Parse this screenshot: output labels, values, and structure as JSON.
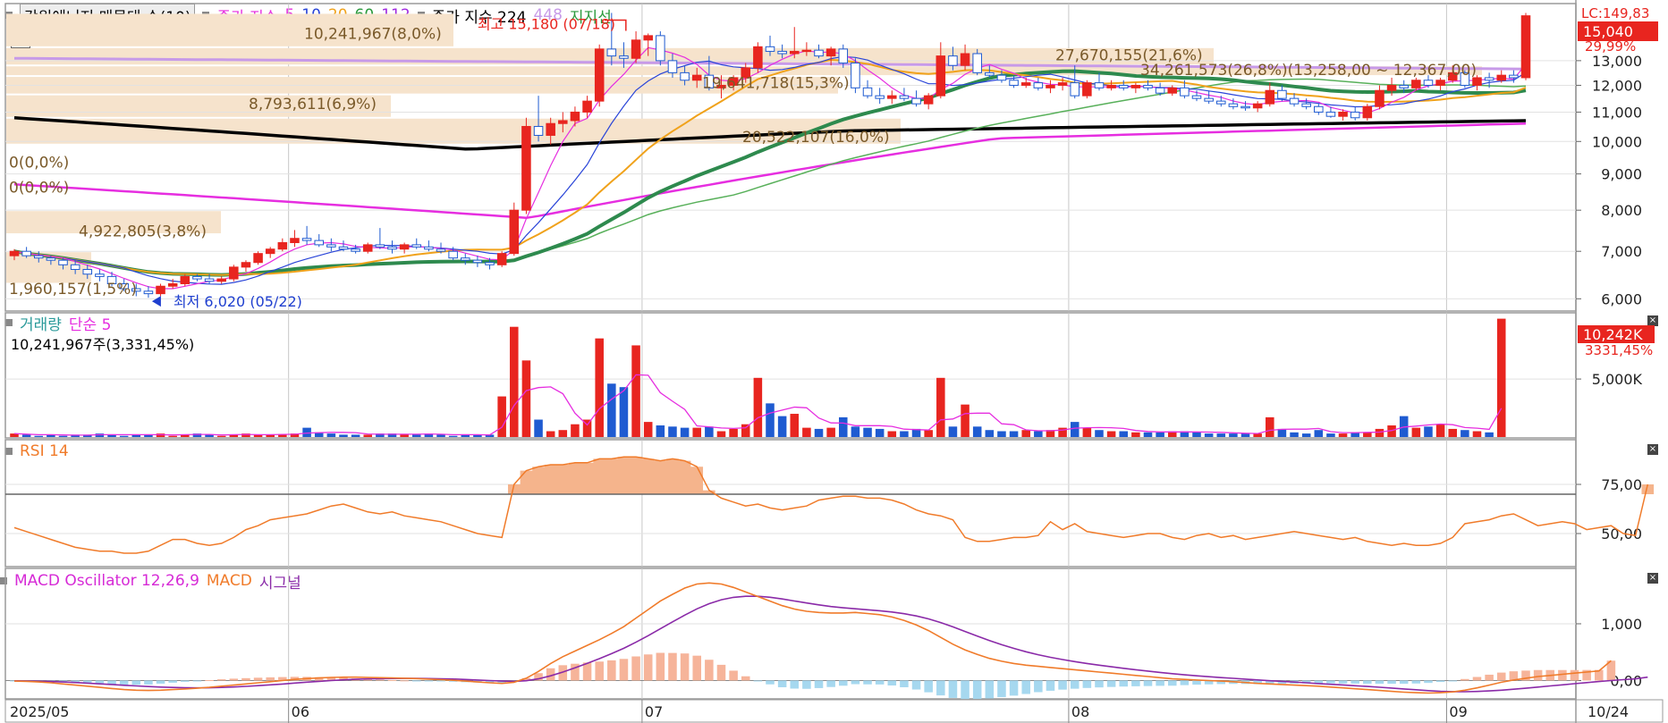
{
  "header": {
    "stock_name": "강원에너지 매물대 수(10)",
    "ma_label": "종가 지수",
    "ma_periods": [
      "5",
      "10",
      "20",
      "60",
      "112"
    ],
    "ma2_label": "종가 지수 224",
    "ma2_extra": "448",
    "support_label": "지지선"
  },
  "colors": {
    "up": "#e8251f",
    "down": "#1f5bd1",
    "ma5": "#2a45d8",
    "ma10": "#2a45d8",
    "ma20": "#f0a21b",
    "ma60": "#2a9a3c",
    "ma112": "#2e8a4e",
    "ma224": "#000000",
    "ma448": "#c79ae8",
    "support": "#e62ee0",
    "volume_band": "#f6e3cc",
    "rsi_line": "#f07b2a",
    "rsi_fill": "#f5b48c",
    "macd": "#f07b2a",
    "signal": "#8a2aa8",
    "osc_pos": "#f6b49a",
    "osc_neg": "#a6d8ef"
  },
  "price_panel": {
    "right_labels": {
      "lc": "LC:149,83",
      "current": "15,040",
      "pct": "29,99%"
    },
    "high_label": "최고 15,180 (07/18)",
    "low_label": "최저 6,020 (05/22)",
    "volume_profile": [
      {
        "label": "10,241,967(8,0%)"
      },
      {
        "label": "27,670,155(21,6%)"
      },
      {
        "label": "34,261,573(26,8%)(13,258,00 ~ 12,367,00)"
      },
      {
        "label": "19,641,718(15,3%)"
      },
      {
        "label": "8,793,611(6,9%)"
      },
      {
        "label": "20,522,107(16,0%)"
      },
      {
        "label": "0(0,0%)"
      },
      {
        "label": "0(0,0%)"
      },
      {
        "label": "4,922,805(3,8%)"
      },
      {
        "label": "1,960,157(1,5%)"
      }
    ]
  },
  "volume_panel": {
    "title": "거래량",
    "ma_label": "단순 5",
    "readout": "10,241,967주(3,331,45%)",
    "right_value": "10,242K",
    "right_pct": "3331,45%"
  },
  "rsi_panel": {
    "title": "RSI 14"
  },
  "macd_panel": {
    "title": "MACD Oscillator 12,26,9",
    "macd_label": "MACD",
    "signal_label": "시그널"
  },
  "chart_data": {
    "type": "candlestick",
    "x_ticks": [
      "2025/05",
      "06",
      "07",
      "08",
      "09",
      "10",
      "10/24"
    ],
    "price_axis": {
      "ylim": [
        5800,
        15200
      ],
      "ticks": [
        6000,
        7000,
        8000,
        9000,
        10000,
        11000,
        12000,
        13000
      ],
      "scale": "log"
    },
    "ohlc": [
      [
        6900,
        7050,
        6800,
        7000
      ],
      [
        7000,
        7100,
        6850,
        6900
      ],
      [
        6900,
        7000,
        6750,
        6850
      ],
      [
        6850,
        6900,
        6700,
        6800
      ],
      [
        6800,
        6850,
        6600,
        6700
      ],
      [
        6700,
        6800,
        6500,
        6600
      ],
      [
        6600,
        6700,
        6400,
        6500
      ],
      [
        6500,
        6600,
        6350,
        6450
      ],
      [
        6450,
        6550,
        6250,
        6300
      ],
      [
        6300,
        6400,
        6150,
        6200
      ],
      [
        6200,
        6300,
        6050,
        6150
      ],
      [
        6150,
        6250,
        6020,
        6100
      ],
      [
        6100,
        6300,
        6050,
        6250
      ],
      [
        6250,
        6400,
        6200,
        6300
      ],
      [
        6300,
        6500,
        6250,
        6450
      ],
      [
        6450,
        6500,
        6350,
        6400
      ],
      [
        6400,
        6500,
        6300,
        6350
      ],
      [
        6350,
        6450,
        6300,
        6400
      ],
      [
        6400,
        6700,
        6350,
        6650
      ],
      [
        6650,
        6800,
        6550,
        6750
      ],
      [
        6750,
        7000,
        6700,
        6950
      ],
      [
        6950,
        7100,
        6850,
        7050
      ],
      [
        7050,
        7300,
        7000,
        7200
      ],
      [
        7200,
        7500,
        7100,
        7300
      ],
      [
        7300,
        7600,
        7150,
        7250
      ],
      [
        7250,
        7400,
        7100,
        7150
      ],
      [
        7150,
        7300,
        7000,
        7100
      ],
      [
        7100,
        7250,
        7000,
        7050
      ],
      [
        7050,
        7150,
        6950,
        7000
      ],
      [
        7000,
        7200,
        6950,
        7150
      ],
      [
        7150,
        7550,
        7050,
        7100
      ],
      [
        7100,
        7250,
        6950,
        7050
      ],
      [
        7050,
        7200,
        6950,
        7150
      ],
      [
        7150,
        7300,
        7050,
        7100
      ],
      [
        7100,
        7250,
        7000,
        7050
      ],
      [
        7050,
        7200,
        6950,
        7000
      ],
      [
        7000,
        7100,
        6800,
        6850
      ],
      [
        6850,
        6950,
        6700,
        6800
      ],
      [
        6800,
        6900,
        6650,
        6750
      ],
      [
        6750,
        6850,
        6600,
        6700
      ],
      [
        6700,
        7000,
        6650,
        6950
      ],
      [
        6950,
        8200,
        6900,
        8000
      ],
      [
        8000,
        10800,
        7900,
        10500
      ],
      [
        10500,
        11600,
        10000,
        10200
      ],
      [
        10200,
        10800,
        9900,
        10600
      ],
      [
        10600,
        11000,
        10300,
        10700
      ],
      [
        10700,
        11200,
        10500,
        11000
      ],
      [
        11000,
        11600,
        10800,
        11400
      ],
      [
        11400,
        13700,
        11200,
        13500
      ],
      [
        13500,
        15180,
        12800,
        13200
      ],
      [
        13200,
        13800,
        12700,
        13100
      ],
      [
        13100,
        14300,
        12900,
        13900
      ],
      [
        13900,
        14200,
        13200,
        14100
      ],
      [
        14100,
        14300,
        12800,
        13000
      ],
      [
        13000,
        13300,
        12300,
        12500
      ],
      [
        12500,
        12800,
        12000,
        12200
      ],
      [
        12200,
        12700,
        11900,
        12400
      ],
      [
        12400,
        13200,
        11800,
        11900
      ],
      [
        11900,
        12400,
        11500,
        12000
      ],
      [
        12000,
        12400,
        11800,
        12300
      ],
      [
        12300,
        12900,
        12100,
        12700
      ],
      [
        12700,
        13800,
        12500,
        13600
      ],
      [
        13600,
        14100,
        13200,
        13400
      ],
      [
        13400,
        13700,
        13100,
        13300
      ],
      [
        13300,
        14500,
        13100,
        13400
      ],
      [
        13400,
        13800,
        13200,
        13450
      ],
      [
        13450,
        13700,
        13100,
        13200
      ],
      [
        13200,
        13600,
        12800,
        13500
      ],
      [
        13500,
        13700,
        12700,
        12900
      ],
      [
        12900,
        13100,
        11700,
        11900
      ],
      [
        11900,
        12200,
        11500,
        11600
      ],
      [
        11600,
        11900,
        11300,
        11500
      ],
      [
        11500,
        11800,
        11300,
        11600
      ],
      [
        11600,
        11900,
        11400,
        11500
      ],
      [
        11500,
        11800,
        11200,
        11300
      ],
      [
        11300,
        11700,
        11100,
        11600
      ],
      [
        11600,
        13800,
        11500,
        13200
      ],
      [
        13200,
        13600,
        12600,
        12800
      ],
      [
        12800,
        13700,
        12600,
        13300
      ],
      [
        13300,
        13500,
        12400,
        12500
      ],
      [
        12500,
        12800,
        12300,
        12400
      ],
      [
        12400,
        12600,
        12100,
        12200
      ],
      [
        12200,
        12400,
        11900,
        12000
      ],
      [
        12000,
        12300,
        11900,
        12100
      ],
      [
        12100,
        12300,
        11800,
        11900
      ],
      [
        11900,
        12200,
        11700,
        12000
      ],
      [
        12000,
        12300,
        11800,
        12100
      ],
      [
        12100,
        12800,
        11500,
        11600
      ],
      [
        11600,
        12200,
        11500,
        12100
      ],
      [
        12100,
        12500,
        11800,
        11900
      ],
      [
        11900,
        12200,
        11800,
        12000
      ],
      [
        12000,
        12200,
        11800,
        11900
      ],
      [
        11900,
        12100,
        11700,
        12000
      ],
      [
        12000,
        12200,
        11800,
        11900
      ],
      [
        11900,
        12100,
        11600,
        11700
      ],
      [
        11700,
        12000,
        11600,
        11900
      ],
      [
        11900,
        12200,
        11500,
        11600
      ],
      [
        11600,
        11800,
        11400,
        11500
      ],
      [
        11500,
        11800,
        11300,
        11400
      ],
      [
        11400,
        11600,
        11200,
        11300
      ],
      [
        11300,
        11500,
        11100,
        11200
      ],
      [
        11200,
        11400,
        11050,
        11150
      ],
      [
        11150,
        11400,
        11000,
        11300
      ],
      [
        11300,
        12100,
        11200,
        11800
      ],
      [
        11800,
        12000,
        11400,
        11500
      ],
      [
        11500,
        11700,
        11200,
        11300
      ],
      [
        11300,
        11500,
        11100,
        11200
      ],
      [
        11200,
        11300,
        10900,
        11000
      ],
      [
        11000,
        11200,
        10800,
        10850
      ],
      [
        10850,
        11100,
        10700,
        11000
      ],
      [
        11000,
        11200,
        10700,
        10800
      ],
      [
        10800,
        11300,
        10700,
        11200
      ],
      [
        11200,
        12000,
        11100,
        11800
      ],
      [
        11800,
        12300,
        11600,
        12000
      ],
      [
        12000,
        12200,
        11700,
        11900
      ],
      [
        11900,
        12300,
        11800,
        12200
      ],
      [
        12200,
        12400,
        11900,
        12000
      ],
      [
        12000,
        12300,
        11800,
        12200
      ],
      [
        12200,
        12800,
        12100,
        12500
      ],
      [
        12500,
        12600,
        11900,
        12000
      ],
      [
        12000,
        12400,
        11800,
        12300
      ],
      [
        12300,
        12500,
        11900,
        12200
      ],
      [
        12200,
        12600,
        12100,
        12400
      ],
      [
        12400,
        12600,
        12100,
        12300
      ],
      [
        12300,
        15180,
        12200,
        15040
      ]
    ],
    "volume": [
      0.3,
      0.2,
      0.1,
      0.2,
      0.1,
      0.2,
      0.2,
      0.3,
      0.2,
      0.1,
      0.2,
      0.2,
      0.3,
      0.1,
      0.2,
      0.3,
      0.2,
      0.1,
      0.2,
      0.3,
      0.2,
      0.2,
      0.2,
      0.3,
      0.8,
      0.4,
      0.3,
      0.2,
      0.2,
      0.2,
      0.3,
      0.3,
      0.2,
      0.2,
      0.3,
      0.2,
      0.1,
      0.2,
      0.2,
      0.2,
      3.5,
      9.5,
      6.6,
      1.5,
      0.5,
      0.6,
      1.1,
      1.5,
      8.5,
      4.6,
      4.3,
      7.9,
      1.3,
      1.0,
      0.9,
      0.8,
      0.8,
      0.9,
      0.5,
      0.7,
      1.1,
      5.1,
      2.9,
      1.8,
      2.0,
      0.8,
      0.7,
      0.8,
      1.7,
      0.9,
      0.8,
      0.7,
      0.5,
      0.5,
      0.7,
      0.6,
      5.1,
      0.9,
      2.8,
      0.9,
      0.6,
      0.5,
      0.5,
      0.6,
      0.5,
      0.6,
      0.8,
      1.3,
      0.8,
      0.6,
      0.5,
      0.5,
      0.4,
      0.4,
      0.4,
      0.5,
      0.5,
      0.4,
      0.3,
      0.3,
      0.3,
      0.3,
      0.3,
      1.7,
      0.7,
      0.4,
      0.3,
      0.6,
      0.3,
      0.3,
      0.4,
      0.4,
      0.7,
      1.0,
      1.8,
      0.8,
      0.9,
      1.1,
      0.7,
      0.6,
      0.5,
      0.4,
      10.2
    ],
    "volume_axis": {
      "unit": "K",
      "ticks": [
        5000
      ]
    },
    "rsi": [
      53,
      51,
      49,
      47,
      45,
      43,
      42,
      41,
      41,
      40,
      40,
      41,
      44,
      47,
      47,
      45,
      44,
      45,
      48,
      52,
      54,
      57,
      58,
      59,
      60,
      62,
      64,
      65,
      63,
      61,
      60,
      61,
      59,
      58,
      57,
      56,
      54,
      52,
      50,
      49,
      48,
      75,
      82,
      84,
      85,
      85,
      86,
      86,
      88,
      88,
      89,
      89,
      88,
      87,
      88,
      87,
      84,
      72,
      68,
      66,
      64,
      65,
      63,
      62,
      63,
      64,
      67,
      68,
      69,
      69,
      68,
      68,
      67,
      65,
      62,
      60,
      59,
      57,
      48,
      46,
      46,
      47,
      48,
      48,
      49,
      56,
      52,
      55,
      51,
      50,
      49,
      48,
      49,
      50,
      50,
      48,
      47,
      49,
      50,
      48,
      49,
      47,
      48,
      49,
      50,
      51,
      50,
      49,
      48,
      47,
      48,
      46,
      45,
      44,
      45,
      44,
      44,
      45,
      48,
      55,
      56,
      57,
      59,
      60,
      57,
      54,
      55,
      56,
      55,
      52,
      53,
      54,
      50,
      49,
      75
    ],
    "rsi_axis": {
      "ticks": [
        50,
        75
      ],
      "overbought": 70
    },
    "macd_axis": {
      "ticks": [
        0,
        1000
      ]
    },
    "macd": [
      -10,
      -15,
      -25,
      -40,
      -60,
      -80,
      -100,
      -120,
      -140,
      -160,
      -170,
      -175,
      -170,
      -160,
      -150,
      -135,
      -120,
      -100,
      -80,
      -60,
      -40,
      -20,
      0,
      20,
      35,
      45,
      55,
      60,
      60,
      55,
      50,
      45,
      40,
      35,
      25,
      15,
      5,
      -10,
      -25,
      -40,
      -50,
      -30,
      40,
      160,
      300,
      420,
      520,
      620,
      720,
      830,
      950,
      1100,
      1250,
      1400,
      1520,
      1630,
      1700,
      1720,
      1700,
      1640,
      1560,
      1480,
      1400,
      1320,
      1260,
      1220,
      1200,
      1190,
      1190,
      1200,
      1180,
      1160,
      1120,
      1060,
      980,
      880,
      760,
      640,
      540,
      460,
      390,
      340,
      300,
      270,
      250,
      230,
      210,
      190,
      170,
      150,
      130,
      110,
      90,
      70,
      50,
      30,
      20,
      10,
      0,
      -10,
      -20,
      -35,
      -50,
      -60,
      -70,
      -80,
      -90,
      -100,
      -115,
      -130,
      -145,
      -160,
      -175,
      -190,
      -205,
      -215,
      -220,
      -215,
      -200,
      -170,
      -130,
      -80,
      -30,
      10,
      40,
      70,
      90,
      110,
      130,
      150,
      170,
      350
    ],
    "signal": [
      -5,
      -8,
      -12,
      -18,
      -26,
      -35,
      -46,
      -58,
      -70,
      -83,
      -95,
      -105,
      -115,
      -122,
      -128,
      -130,
      -128,
      -122,
      -113,
      -102,
      -90,
      -76,
      -61,
      -45,
      -29,
      -14,
      0,
      12,
      22,
      29,
      33,
      36,
      37,
      37,
      35,
      31,
      26,
      19,
      10,
      0,
      -10,
      -14,
      -3,
      30,
      84,
      150,
      224,
      303,
      386,
      474,
      569,
      675,
      790,
      912,
      1034,
      1153,
      1262,
      1354,
      1423,
      1466,
      1485,
      1484,
      1467,
      1438,
      1402,
      1366,
      1333,
      1304,
      1281,
      1264,
      1247,
      1229,
      1207,
      1178,
      1138,
      1087,
      1022,
      946,
      865,
      784,
      705,
      632,
      566,
      507,
      455,
      410,
      370,
      334,
      301,
      271,
      243,
      216,
      191,
      167,
      143,
      121,
      101,
      83,
      67,
      52,
      39,
      25,
      11,
      -3,
      -15,
      -27,
      -40,
      -53,
      -66,
      -78,
      -91,
      -104,
      -118,
      -133,
      -148,
      -163,
      -178,
      -190,
      -196,
      -197,
      -193,
      -183,
      -170,
      -153,
      -135,
      -115,
      -95,
      -75,
      -55,
      -36,
      -17,
      0,
      15,
      30,
      60
    ]
  }
}
